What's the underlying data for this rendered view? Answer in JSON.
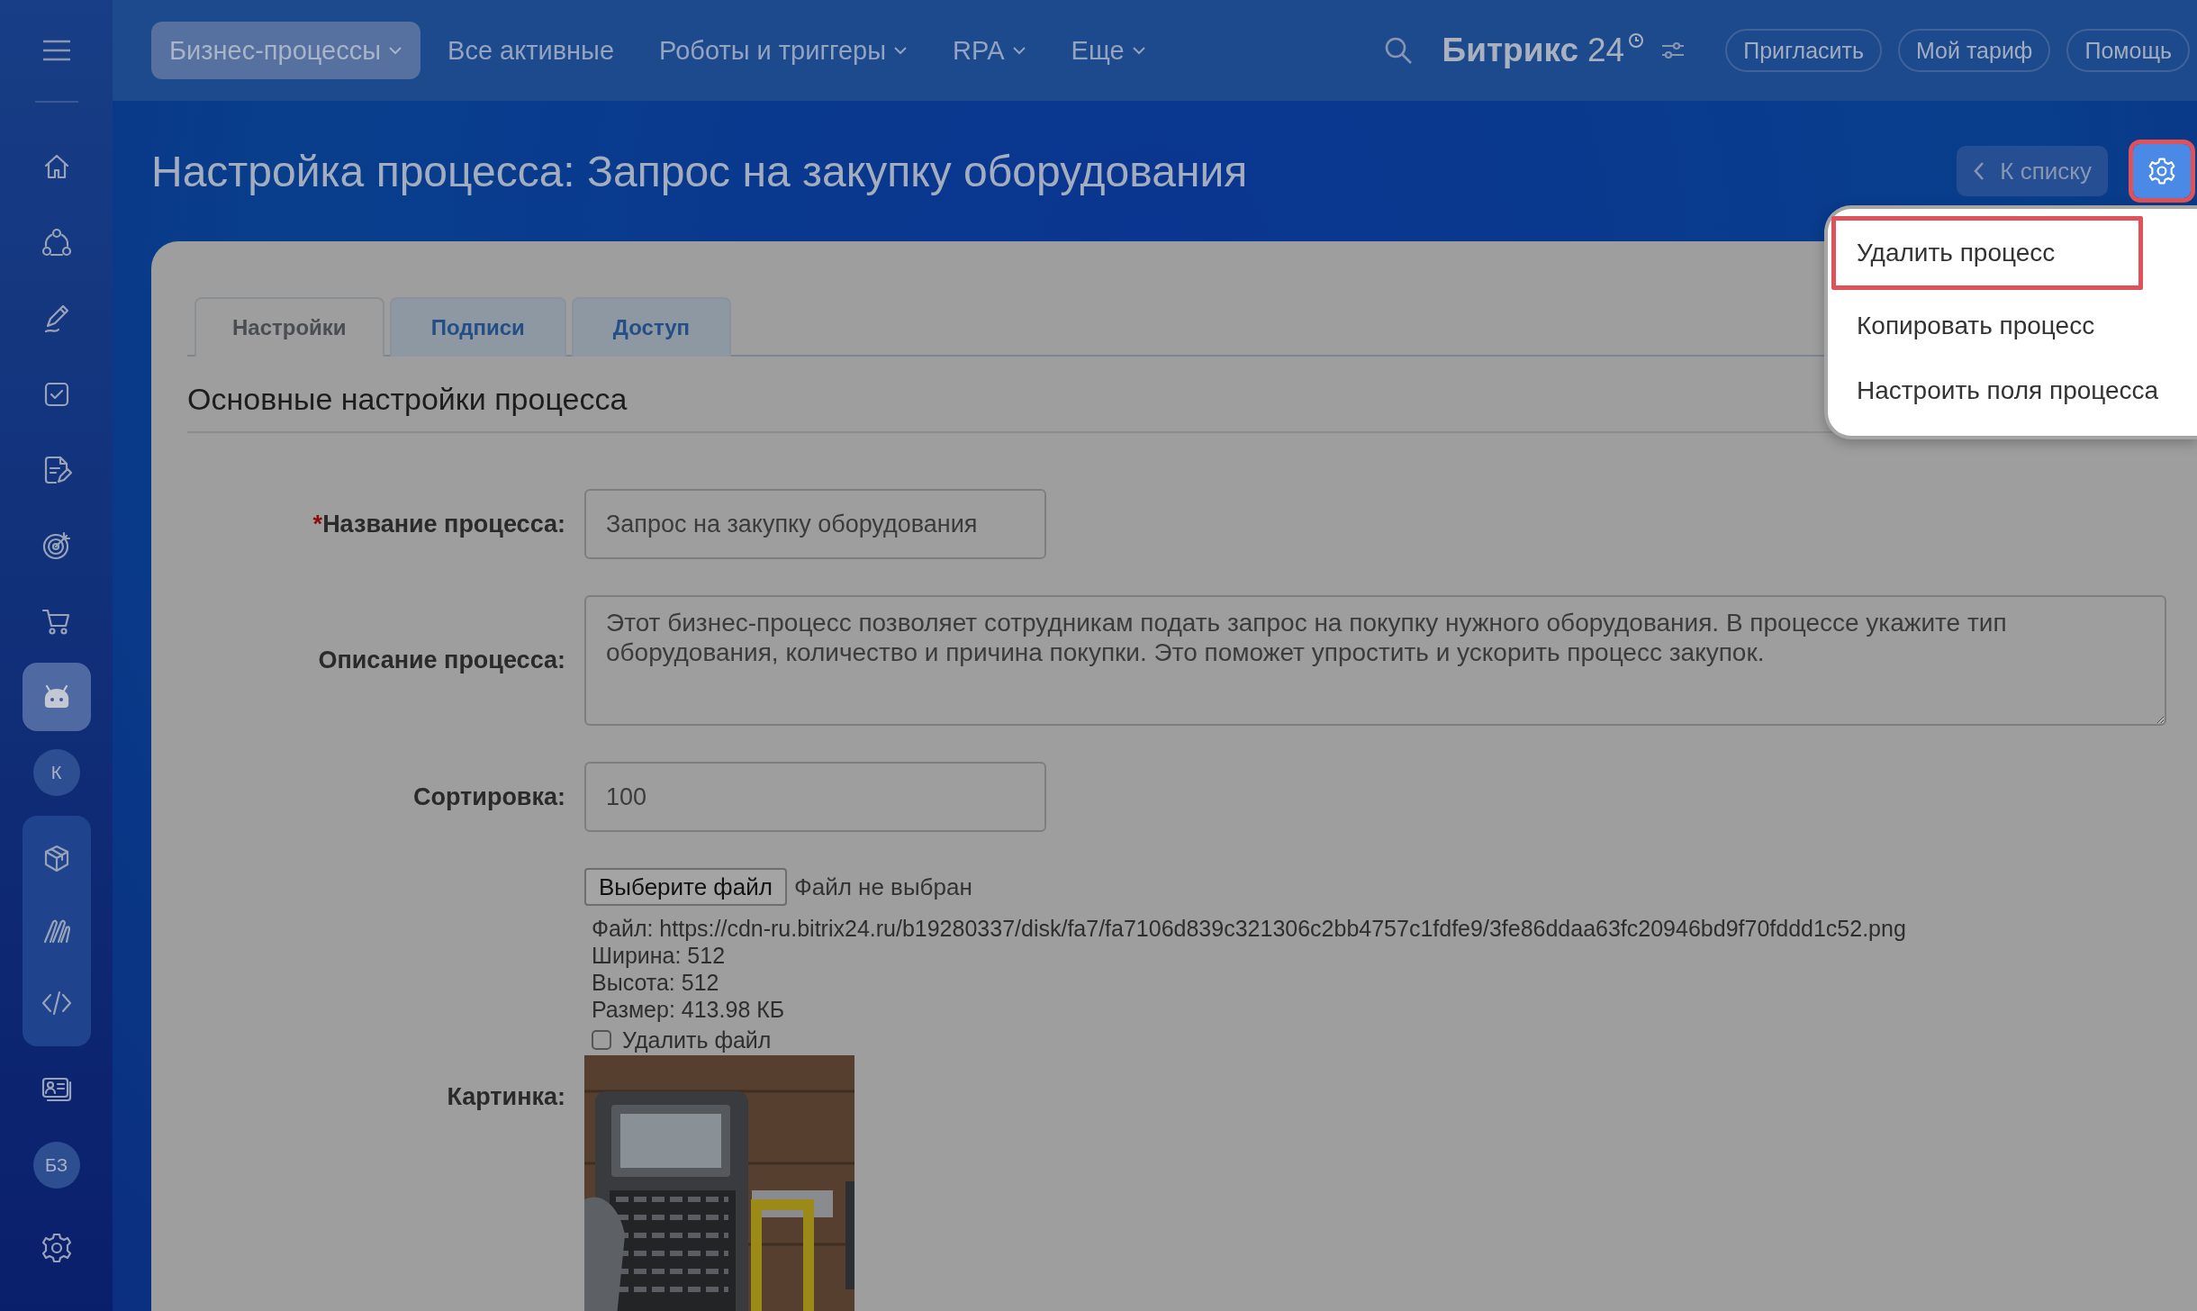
{
  "topbar": {
    "nav": [
      {
        "label": "Бизнес-процессы",
        "selected": true,
        "dropdown": true
      },
      {
        "label": "Все активные",
        "selected": false,
        "dropdown": false
      },
      {
        "label": "Роботы и триггеры",
        "selected": false,
        "dropdown": true
      },
      {
        "label": "RPA",
        "selected": false,
        "dropdown": true
      },
      {
        "label": "Еще",
        "selected": false,
        "dropdown": true
      }
    ],
    "logo": {
      "name": "Битрикс",
      "number": "24"
    },
    "buttons": [
      "Пригласить",
      "Мой тариф",
      "Помощь"
    ]
  },
  "sidebar": {
    "items": [
      {
        "kind": "icon",
        "selected": false
      },
      {
        "kind": "icon",
        "selected": false
      },
      {
        "kind": "icon",
        "selected": false
      },
      {
        "kind": "icon",
        "selected": false
      },
      {
        "kind": "icon",
        "selected": false
      },
      {
        "kind": "icon",
        "selected": false
      },
      {
        "kind": "icon",
        "selected": false
      },
      {
        "kind": "icon",
        "selected": true
      },
      {
        "kind": "avatar",
        "label": "К",
        "selected": false
      },
      {
        "kind": "group",
        "children": [
          {
            "kind": "icon",
            "selected": false
          },
          {
            "kind": "icon",
            "selected": false
          },
          {
            "kind": "icon",
            "selected": false
          }
        ]
      },
      {
        "kind": "icon",
        "selected": false
      },
      {
        "kind": "avatar",
        "label": "БЗ",
        "selected": false
      }
    ]
  },
  "page": {
    "title": "Настройка процесса: Запрос на закупку оборудования",
    "back_button": "К списку",
    "settings_button": {
      "highlighted": true
    },
    "menu": [
      {
        "label": "Удалить процесс",
        "highlighted": true
      },
      {
        "label": "Копировать процесс",
        "highlighted": false
      },
      {
        "label": "Настроить поля процесса",
        "highlighted": false
      }
    ],
    "tabs": [
      {
        "label": "Настройки",
        "selected": true
      },
      {
        "label": "Подписи",
        "selected": false
      },
      {
        "label": "Доступ",
        "selected": false
      }
    ],
    "section_title": "Основные настройки процесса",
    "fields": [
      {
        "kind": "text",
        "mark": "*",
        "label": "Название процесса:",
        "value": "Запрос на закупку оборудования"
      },
      {
        "kind": "textarea",
        "label": "Описание процесса:",
        "value": "Этот бизнес-процесс позволяет сотрудникам подать запрос на покупку нужного оборудования. В процессе укажите тип оборудования, количество и причина покупки. Это поможет упростить и ускорить процесс закупок."
      },
      {
        "kind": "text",
        "label": "Сортировка:",
        "value": "100"
      },
      {
        "kind": "file",
        "label": "Картинка:",
        "button": "Выберите файл",
        "status": "Файл не выбран",
        "info": [
          "Файл: https://cdn-ru.bitrix24.ru/b19280337/disk/fa7/fa7106d839c321306c2bb4757c1fdfe9/3fe86ddaa63fc20946bd9f70fddd1c52.png",
          "Ширина: 512",
          "Высота: 512",
          "Размер: 413.98 КБ"
        ],
        "delete": {
          "label": "Удалить файл",
          "checked": false
        },
        "preview": {
          "kind": "picture"
        }
      }
    ]
  }
}
